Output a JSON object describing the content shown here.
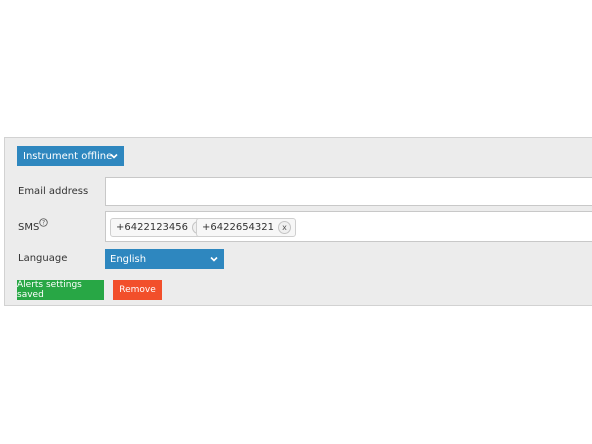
{
  "alert": {
    "type_label": "Instrument offline",
    "type_icon": "chevron-down-icon"
  },
  "email": {
    "label": "Email address",
    "value": ""
  },
  "sms": {
    "label": "SMS",
    "help_icon": "help-icon",
    "numbers": [
      "+6422123456",
      "+6422654321"
    ],
    "remove_glyph": "x"
  },
  "language": {
    "label": "Language",
    "selected": "English",
    "icon": "chevron-down-icon"
  },
  "buttons": {
    "save_label": "Alerts settings saved",
    "remove_label": "Remove"
  },
  "colors": {
    "select_blue": "#2e87bf",
    "save_green": "#28a745",
    "remove_red": "#f24f2b",
    "panel_bg": "#ececec"
  }
}
